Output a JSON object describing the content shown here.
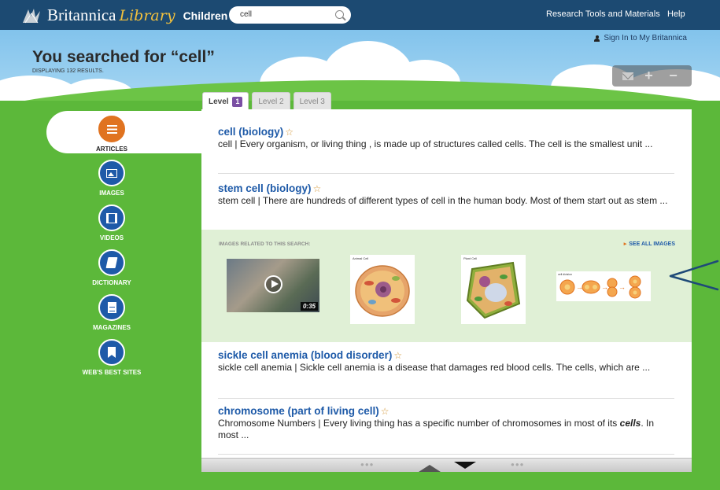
{
  "topbar": {
    "brand": "Britannica",
    "library": "Library",
    "children": "Children",
    "search_value": "cell",
    "links": [
      "Research Tools and Materials",
      "Help"
    ]
  },
  "header": {
    "title": "You searched for “cell”",
    "subtitle": "DISPLAYING 132 RESULTS.",
    "signin": "Sign In to My Britannica",
    "tools": [
      "mail-icon",
      "plus-icon",
      "minus-icon"
    ]
  },
  "sidebar": {
    "items": [
      {
        "label": "ARTICLES",
        "icon": "list-icon",
        "active": true
      },
      {
        "label": "IMAGES",
        "icon": "image-icon",
        "active": false
      },
      {
        "label": "VIDEOS",
        "icon": "film-icon",
        "active": false
      },
      {
        "label": "DICTIONARY",
        "icon": "book-icon",
        "active": false
      },
      {
        "label": "MAGAZINES",
        "icon": "document-icon",
        "active": false
      },
      {
        "label": "WEB'S BEST SITES",
        "icon": "bookmark-icon",
        "active": false
      }
    ]
  },
  "levels": {
    "tab1": "Level",
    "tab1_badge": "1",
    "tab2": "Level 2",
    "tab3": "Level 3"
  },
  "results": [
    {
      "title": "cell (biology)",
      "snippet": "cell   |   Every organism, or living thing , is made up of structures called cells. The cell is the smallest unit ..."
    },
    {
      "title": "stem cell (biology)",
      "snippet": "stem cell   |   There are hundreds of different types of cell in the human body. Most of them start out as stem ..."
    },
    {
      "title": "sickle cell anemia (blood disorder)",
      "snippet": "sickle cell anemia   |   Sickle cell anemia is a disease that damages red blood cells. The cells, which are ..."
    },
    {
      "title": "chromosome (part of living cell)",
      "snippet_before": "Chromosome Numbers  | Every living thing has a specific number of chromosomes in most of its ",
      "snippet_em": "cells",
      "snippet_after": ". In most ..."
    }
  ],
  "images": {
    "label": "IMAGES RELATED TO THIS SEARCH:",
    "see_all": "SEE ALL IMAGES",
    "video_duration": "0:35",
    "animal_cell_caption": "Animal Cell",
    "plant_cell_caption": "Plant Cell",
    "division_caption": "cell division"
  },
  "colors": {
    "topbar": "#1c4a72",
    "link": "#1e5aa8",
    "accent": "#e07320",
    "grass": "#5cb83a"
  }
}
